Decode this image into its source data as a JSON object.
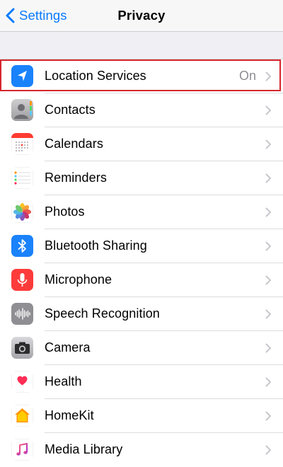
{
  "nav": {
    "back_label": "Settings",
    "title": "Privacy"
  },
  "rows": [
    {
      "label": "Location Services",
      "value": "On",
      "icon": "location-arrow-icon"
    },
    {
      "label": "Contacts",
      "value": "",
      "icon": "contacts-icon"
    },
    {
      "label": "Calendars",
      "value": "",
      "icon": "calendar-icon"
    },
    {
      "label": "Reminders",
      "value": "",
      "icon": "reminders-icon"
    },
    {
      "label": "Photos",
      "value": "",
      "icon": "photos-icon"
    },
    {
      "label": "Bluetooth Sharing",
      "value": "",
      "icon": "bluetooth-icon"
    },
    {
      "label": "Microphone",
      "value": "",
      "icon": "microphone-icon"
    },
    {
      "label": "Speech Recognition",
      "value": "",
      "icon": "speech-waveform-icon"
    },
    {
      "label": "Camera",
      "value": "",
      "icon": "camera-icon"
    },
    {
      "label": "Health",
      "value": "",
      "icon": "health-heart-icon"
    },
    {
      "label": "HomeKit",
      "value": "",
      "icon": "homekit-house-icon"
    },
    {
      "label": "Media Library",
      "value": "",
      "icon": "media-library-music-icon"
    }
  ],
  "colors": {
    "accent": "#0a7aff",
    "highlight_box": "#d5262b",
    "background": "#efeff4"
  }
}
